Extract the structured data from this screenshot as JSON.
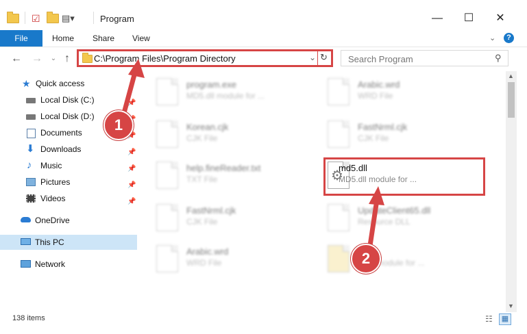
{
  "window": {
    "title": "Program",
    "minimize_glyph": "—",
    "maximize_glyph": "☐",
    "close_glyph": "✕"
  },
  "ribbon": {
    "tabs": [
      "File",
      "Home",
      "Share",
      "View"
    ],
    "help_glyph": "?"
  },
  "address": {
    "path": "C:\\Program Files\\Program Directory"
  },
  "search": {
    "placeholder": "Search Program"
  },
  "sidebar": {
    "items": [
      {
        "label": "Quick access",
        "icon": "star-icon",
        "pinned": false
      },
      {
        "label": "Local Disk (C:)",
        "icon": "drive-icon",
        "pinned": true
      },
      {
        "label": "Local Disk (D:)",
        "icon": "drive-icon",
        "pinned": true
      },
      {
        "label": "Documents",
        "icon": "documents-icon",
        "pinned": true
      },
      {
        "label": "Downloads",
        "icon": "download-icon",
        "pinned": true
      },
      {
        "label": "Music",
        "icon": "music-icon",
        "pinned": true
      },
      {
        "label": "Pictures",
        "icon": "pictures-icon",
        "pinned": true
      },
      {
        "label": "Videos",
        "icon": "videos-icon",
        "pinned": true
      },
      {
        "label": "OneDrive",
        "icon": "cloud-icon",
        "pinned": false
      },
      {
        "label": "This PC",
        "icon": "computer-icon",
        "pinned": false
      },
      {
        "label": "Network",
        "icon": "network-icon",
        "pinned": false
      }
    ]
  },
  "files": [
    {
      "name": "program.exe",
      "type": "MD5.dll module for ..."
    },
    {
      "name": "Arabic.wrd",
      "type": "WRD File"
    },
    {
      "name": "Korean.cjk",
      "type": "CJK File"
    },
    {
      "name": "FastNrml.cjk",
      "type": "CJK File"
    },
    {
      "name": "help.fineReader.txt",
      "type": "TXT File"
    },
    {
      "name": "md5.dll",
      "type": "MD5.dll module for ..."
    },
    {
      "name": "FastNrml.cjk",
      "type": "CJK File"
    },
    {
      "name": "UpdateClient65.dll",
      "type": "Resource DLL"
    },
    {
      "name": "Arabic.wrd",
      "type": "WRD File"
    },
    {
      "name": "",
      "type": "dll module for ..."
    }
  ],
  "markers": {
    "first": "1",
    "second": "2"
  },
  "status": {
    "item_count": "138 items"
  },
  "colors": {
    "accent": "#1979ca",
    "highlight": "#d64545",
    "selected": "#cde5f7"
  }
}
